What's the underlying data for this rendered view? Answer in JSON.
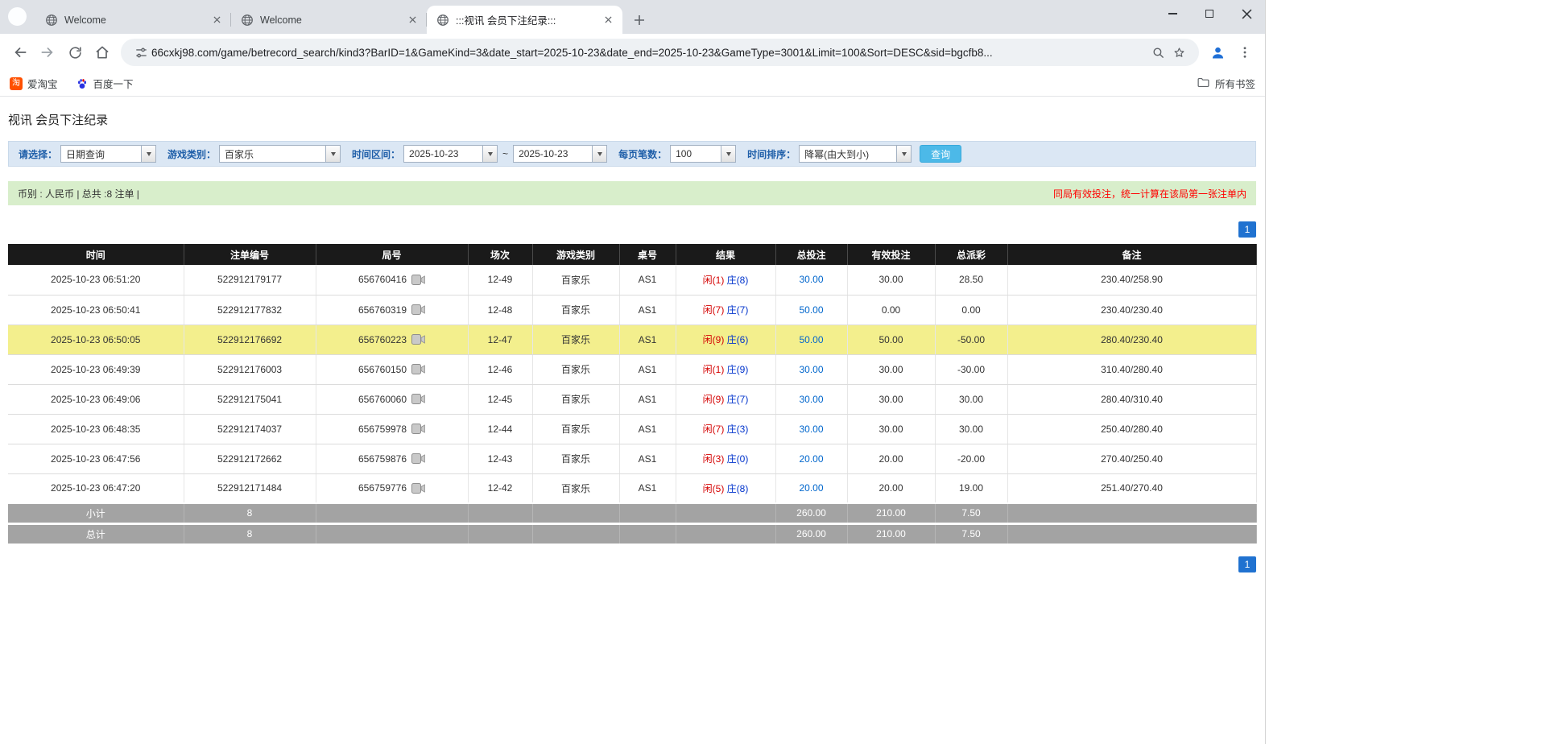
{
  "browser": {
    "tabs": [
      {
        "title": "Welcome"
      },
      {
        "title": "Welcome"
      },
      {
        "title": ":::视讯 会员下注纪录:::"
      }
    ],
    "url": "66cxkj98.com/game/betrecord_search/kind3?BarID=1&GameKind=3&date_start=2025-10-23&date_end=2025-10-23&GameType=3001&Limit=100&Sort=DESC&sid=bgcfb8...",
    "bookmarks": [
      {
        "label": "爱淘宝",
        "icon_glyph": "淘"
      },
      {
        "label": "百度一下"
      }
    ],
    "all_bookmarks": "所有书签"
  },
  "page": {
    "title": "视讯 会员下注纪录",
    "filters": {
      "select_label": "请选择：",
      "select_value": "日期查询",
      "game_label": "游戏类别：",
      "game_value": "百家乐",
      "range_label": "时间区间：",
      "date_start": "2025-10-23",
      "range_sep": "~",
      "date_end": "2025-10-23",
      "page_size_label": "每页笔数：",
      "page_size_value": "100",
      "sort_label": "时间排序：",
      "sort_value": "降幂(由大到小)",
      "search_button": "查询"
    },
    "summary": {
      "info": "币别 : 人民币 | 总共 :8 注单 |",
      "note": "同局有效投注，统一计算在该局第一张注单内"
    },
    "pagination": {
      "page": "1"
    },
    "table": {
      "headers": [
        "时间",
        "注单编号",
        "局号",
        "场次",
        "游戏类别",
        "桌号",
        "结果",
        "总投注",
        "有效投注",
        "总派彩",
        "备注"
      ],
      "rows": [
        {
          "time": "2025-10-23 06:51:20",
          "bet_id": "522912179177",
          "round": "656760416",
          "session": "12-49",
          "game": "百家乐",
          "table_no": "AS1",
          "result_player": "闲(1)",
          "result_banker": "庄(8)",
          "total_bet": "30.00",
          "valid_bet": "30.00",
          "payout": "28.50",
          "remark": "230.40/258.90",
          "highlight": false
        },
        {
          "time": "2025-10-23 06:50:41",
          "bet_id": "522912177832",
          "round": "656760319",
          "session": "12-48",
          "game": "百家乐",
          "table_no": "AS1",
          "result_player": "闲(7)",
          "result_banker": "庄(7)",
          "total_bet": "50.00",
          "valid_bet": "0.00",
          "payout": "0.00",
          "remark": "230.40/230.40",
          "highlight": false
        },
        {
          "time": "2025-10-23 06:50:05",
          "bet_id": "522912176692",
          "round": "656760223",
          "session": "12-47",
          "game": "百家乐",
          "table_no": "AS1",
          "result_player": "闲(9)",
          "result_banker": "庄(6)",
          "total_bet": "50.00",
          "valid_bet": "50.00",
          "payout": "-50.00",
          "remark": "280.40/230.40",
          "highlight": true
        },
        {
          "time": "2025-10-23 06:49:39",
          "bet_id": "522912176003",
          "round": "656760150",
          "session": "12-46",
          "game": "百家乐",
          "table_no": "AS1",
          "result_player": "闲(1)",
          "result_banker": "庄(9)",
          "total_bet": "30.00",
          "valid_bet": "30.00",
          "payout": "-30.00",
          "remark": "310.40/280.40",
          "highlight": false
        },
        {
          "time": "2025-10-23 06:49:06",
          "bet_id": "522912175041",
          "round": "656760060",
          "session": "12-45",
          "game": "百家乐",
          "table_no": "AS1",
          "result_player": "闲(9)",
          "result_banker": "庄(7)",
          "total_bet": "30.00",
          "valid_bet": "30.00",
          "payout": "30.00",
          "remark": "280.40/310.40",
          "highlight": false
        },
        {
          "time": "2025-10-23 06:48:35",
          "bet_id": "522912174037",
          "round": "656759978",
          "session": "12-44",
          "game": "百家乐",
          "table_no": "AS1",
          "result_player": "闲(7)",
          "result_banker": "庄(3)",
          "total_bet": "30.00",
          "valid_bet": "30.00",
          "payout": "30.00",
          "remark": "250.40/280.40",
          "highlight": false
        },
        {
          "time": "2025-10-23 06:47:56",
          "bet_id": "522912172662",
          "round": "656759876",
          "session": "12-43",
          "game": "百家乐",
          "table_no": "AS1",
          "result_player": "闲(3)",
          "result_banker": "庄(0)",
          "total_bet": "20.00",
          "valid_bet": "20.00",
          "payout": "-20.00",
          "remark": "270.40/250.40",
          "highlight": false
        },
        {
          "time": "2025-10-23 06:47:20",
          "bet_id": "522912171484",
          "round": "656759776",
          "session": "12-42",
          "game": "百家乐",
          "table_no": "AS1",
          "result_player": "闲(5)",
          "result_banker": "庄(8)",
          "total_bet": "20.00",
          "valid_bet": "20.00",
          "payout": "19.00",
          "remark": "251.40/270.40",
          "highlight": false
        }
      ],
      "subtotal": {
        "label": "小计",
        "count": "8",
        "total_bet": "260.00",
        "valid_bet": "210.00",
        "payout": "7.50"
      },
      "total": {
        "label": "总计",
        "count": "8",
        "total_bet": "260.00",
        "valid_bet": "210.00",
        "payout": "7.50"
      }
    }
  }
}
